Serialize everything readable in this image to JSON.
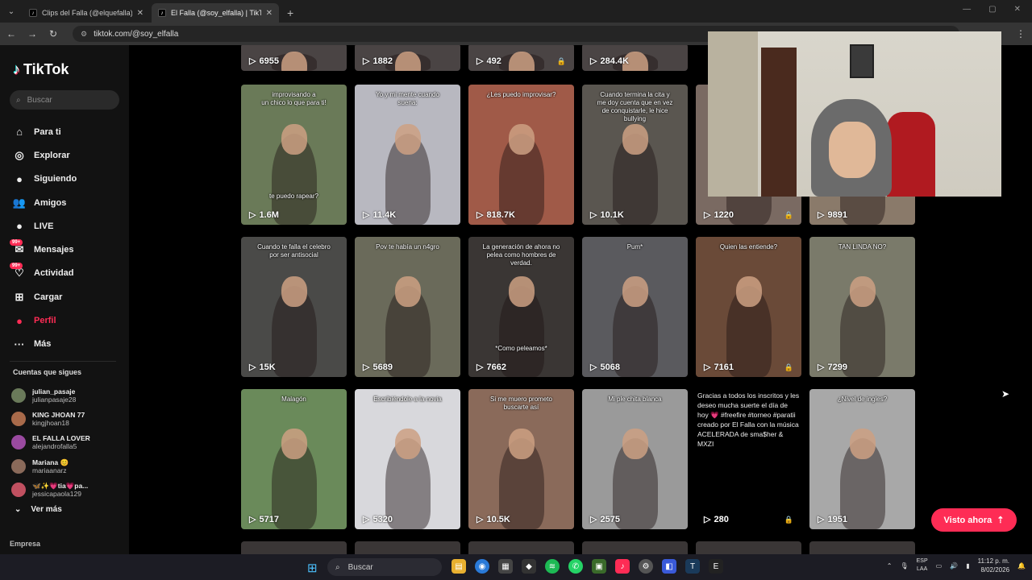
{
  "browser": {
    "tabs": [
      {
        "title": "Clips del Falla (@elquefalla) | Ti",
        "active": false
      },
      {
        "title": "El Falla (@soy_elfalla) | TikTok",
        "active": true
      }
    ],
    "url": "tiktok.com/@soy_elfalla"
  },
  "sidebar": {
    "brand": "TikTok",
    "search_placeholder": "Buscar",
    "nav": [
      {
        "label": "Para ti",
        "icon": "home-icon",
        "glyph": "⌂"
      },
      {
        "label": "Explorar",
        "icon": "compass-icon",
        "glyph": "◎"
      },
      {
        "label": "Siguiendo",
        "icon": "following-icon",
        "glyph": "●"
      },
      {
        "label": "Amigos",
        "icon": "friends-icon",
        "glyph": "👥"
      },
      {
        "label": "LIVE",
        "icon": "live-icon",
        "glyph": "●"
      },
      {
        "label": "Mensajes",
        "icon": "messages-icon",
        "glyph": "✉",
        "badge": "99+"
      },
      {
        "label": "Actividad",
        "icon": "activity-icon",
        "glyph": "♡",
        "badge": "99+"
      },
      {
        "label": "Cargar",
        "icon": "upload-icon",
        "glyph": "⊞"
      },
      {
        "label": "Perfil",
        "icon": "profile-icon",
        "glyph": "●",
        "active": true
      },
      {
        "label": "Más",
        "icon": "more-icon",
        "glyph": "···"
      }
    ],
    "following_header": "Cuentas que sigues",
    "following": [
      {
        "name": "julian_pasaje",
        "handle": "julianpasaje28",
        "color": "#6a7a5a"
      },
      {
        "name": "KING JHOAN 77",
        "handle": "kingjhoan18",
        "color": "#a86a4a"
      },
      {
        "name": "EL FALLA LOVER",
        "handle": "alejandrofalla5",
        "color": "#9a4aa0"
      },
      {
        "name": "Mariana 😊",
        "handle": "mariaanarz",
        "color": "#8a6a5a"
      },
      {
        "name": "🦋✨💗tia💗pa...",
        "handle": "jessicapaola129",
        "color": "#c05060"
      }
    ],
    "see_more": "Ver más",
    "footer": "Empresa"
  },
  "grid": {
    "top_row": [
      {
        "views": "6955",
        "locked": false
      },
      {
        "views": "1882",
        "locked": false
      },
      {
        "views": "492",
        "locked": true
      },
      {
        "views": "284.4K",
        "locked": false
      }
    ],
    "rows": [
      [
        {
          "views": "1.6M",
          "caption": "improvisando a\nun chico lo que para ti!",
          "caption2": "te puedo rapear?",
          "bg": "#6a7a58",
          "locked": false
        },
        {
          "views": "11.4K",
          "caption": "Yo y mi mente cuando\nsuena:",
          "bg": "#b8b8c0",
          "locked": false
        },
        {
          "views": "818.7K",
          "caption": "¿Les puedo improvisar?",
          "bg": "#a05a48",
          "locked": false
        },
        {
          "views": "10.1K",
          "caption": "Cuando termina la cita y\nme doy cuenta que en vez\nde conquistarle, le hice\nbullying",
          "bg": "#5a5650",
          "locked": false
        },
        {
          "views": "1220",
          "caption": "",
          "bg": "#7a6a62",
          "locked": true
        },
        {
          "views": "9891",
          "caption": "",
          "bg": "#8a7a6a",
          "locked": false
        }
      ],
      [
        {
          "views": "15K",
          "caption": "Cuando te falla el celebro\npor ser antisocial",
          "bg": "#4a4a48",
          "locked": false
        },
        {
          "views": "5689",
          "caption": "Pov te había un n4gro",
          "bg": "#6a6a5a",
          "locked": false
        },
        {
          "views": "7662",
          "caption": "La generación de ahora no\npelea como hombres de\nverdad.",
          "caption2": "*Como peleamos*",
          "bg": "#3a3634",
          "locked": false
        },
        {
          "views": "5068",
          "caption": "Pum*",
          "bg": "#5a5a5e",
          "locked": false
        },
        {
          "views": "7161",
          "caption": "Quien las entiende?",
          "bg": "#6a4a38",
          "locked": true
        },
        {
          "views": "7299",
          "caption": "TAN LINDA NO?",
          "bg": "#7a7a6a",
          "locked": false
        }
      ],
      [
        {
          "views": "5717",
          "caption": "Malagón",
          "bg": "#6a8a5a",
          "locked": false
        },
        {
          "views": "5320",
          "caption": "Escribiéndole a la novia",
          "bg": "#d8d8dc",
          "locked": false
        },
        {
          "views": "10.5K",
          "caption": "Si me muero prometo\nbuscarte así",
          "bg": "#8a6a5a",
          "locked": false
        },
        {
          "views": "2575",
          "caption": "Mi ple chita blanca",
          "bg": "#9a9a9a",
          "locked": false
        },
        {
          "views": "280",
          "description": "Gracias a todos los inscritos y les deseo mucha suerte el día de hoy 💗 #freefire #torneo #paratii creado por El Falla con la música ACELERADA de sma$her & MXZI",
          "bg": "#000",
          "locked": true
        },
        {
          "views": "1951",
          "caption": "¿Nivel de ingles?",
          "bg": "#a8a8a8",
          "locked": false
        }
      ]
    ]
  },
  "visto_button": "Visto ahora",
  "taskbar": {
    "search_placeholder": "Buscar",
    "lang": "ESP\nLAA",
    "time": "11:12 p. m.",
    "date": "8/02/2026"
  },
  "colors": {
    "accent": "#fe2c55",
    "bg": "#000000",
    "sidebar": "#121212"
  }
}
